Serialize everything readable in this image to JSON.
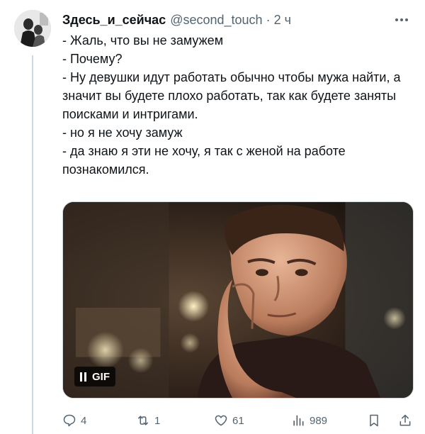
{
  "tweet": {
    "display_name": "Здесь_и_сейчас",
    "handle": "@second_touch",
    "separator": "·",
    "time": "2 ч",
    "lines": [
      "- Жаль, что вы не замужем",
      "- Почему?",
      "- Ну девушки идут работать обычно чтобы мужа найти, а значит вы будете плохо работать, так как будете заняты поисками и интригами.",
      "- но я не хочу замуж",
      "- да знаю я эти не хочу, я так с женой на работе познакомился."
    ]
  },
  "media": {
    "badge_label": "GIF",
    "pause_icon": "pause-icon"
  },
  "actions": {
    "reply_count": "4",
    "retweet_count": "1",
    "like_count": "61",
    "views_count": "989",
    "icons": [
      "reply-icon",
      "retweet-icon",
      "like-icon",
      "views-icon",
      "bookmark-icon",
      "share-icon"
    ]
  },
  "colors": {
    "text": "#0f1419",
    "secondary": "#536471",
    "border": "#cfd9de"
  }
}
